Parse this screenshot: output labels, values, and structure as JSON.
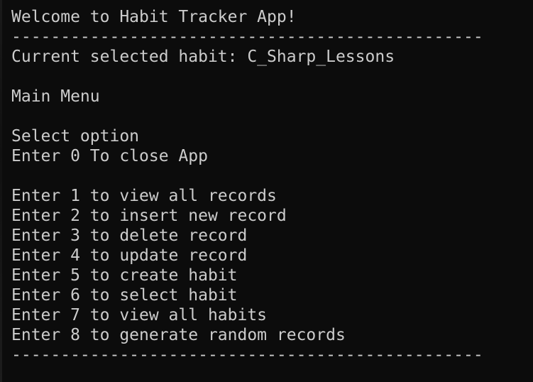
{
  "terminal": {
    "welcome": "Welcome to Habit Tracker App!",
    "separator": "------------------------------------------------",
    "current_habit": "Current selected habit: C_Sharp_Lessons",
    "menu_title": "Main Menu",
    "select_option": "Select option",
    "close_option": "Enter 0 To close App",
    "options": [
      "Enter 1 to view all records",
      "Enter 2 to insert new record",
      "Enter 3 to delete record",
      "Enter 4 to update record",
      "Enter 5 to create habit",
      "Enter 6 to select habit",
      "Enter 7 to view all habits",
      "Enter 8 to generate random records"
    ]
  },
  "colors": {
    "background": "#0c0c0c",
    "foreground": "#cccccc"
  }
}
